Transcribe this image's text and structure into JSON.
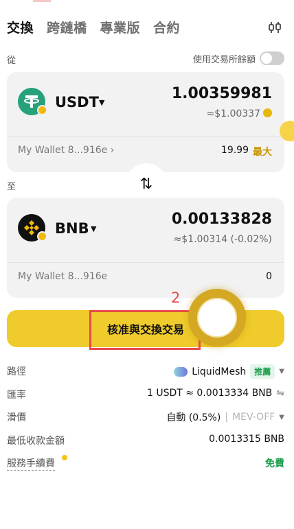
{
  "tabs": [
    "交換",
    "跨鏈橋",
    "專業版",
    "合約"
  ],
  "from": {
    "section_label": "從",
    "use_balance_label": "使用交易所餘額",
    "token": "USDT",
    "amount": "1.00359981",
    "usd_value": "≈$1.00337",
    "wallet": "My Wallet 8...916e",
    "balance": "19.99",
    "max_label": "最大"
  },
  "to": {
    "section_label": "至",
    "token": "BNB",
    "amount": "0.00133828",
    "usd_value": "≈$1.00314 (-0.02%)",
    "wallet": "My Wallet 8...916e",
    "balance": "0"
  },
  "swap_direction_icon": "⇅",
  "main_button_label": "核准與交換交易",
  "annotation_number": "2",
  "details": {
    "route_label": "路徑",
    "route_value": "LiquidMesh",
    "route_badge": "推薦",
    "rate_label": "匯率",
    "rate_value": "1 USDT ≈ 0.0013334 BNB",
    "slippage_label": "滑價",
    "slippage_value": "自動 (0.5%)",
    "mev_value": "MEV-OFF",
    "min_receive_label": "最低收款金額",
    "min_receive_value": "0.0013315 BNB",
    "fee_label": "服務手續費",
    "fee_value": "免費"
  },
  "colors": {
    "accent": "#efcb2c",
    "usdt": "#26a17b",
    "bnb": "#f0b90b",
    "annotation": "#e84b4b",
    "success": "#1a9c4a"
  }
}
